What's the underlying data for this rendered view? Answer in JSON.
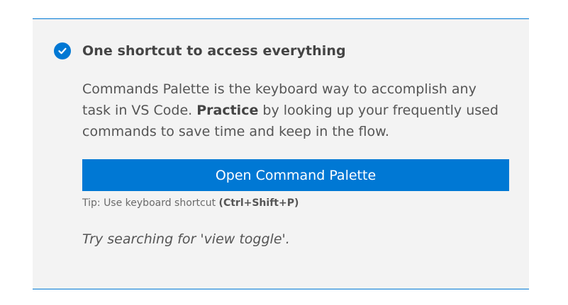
{
  "step": {
    "title": "One shortcut to access everything",
    "completed_icon": "check-circle-icon",
    "description": {
      "part1": "Commands Palette is the keyboard way to accomplish any task in VS Code. ",
      "emphasis": "Practice",
      "part2": " by looking up your frequently used commands to save time and keep in the flow."
    },
    "button_label": "Open Command Palette",
    "tip": {
      "prefix": "Tip: Use keyboard shortcut ",
      "shortcut": "(Ctrl+Shift+P)"
    },
    "try_text": "Try searching for 'view toggle'."
  },
  "colors": {
    "accent": "#0078d4",
    "card_background": "#f3f3f3",
    "text": "#555555"
  }
}
